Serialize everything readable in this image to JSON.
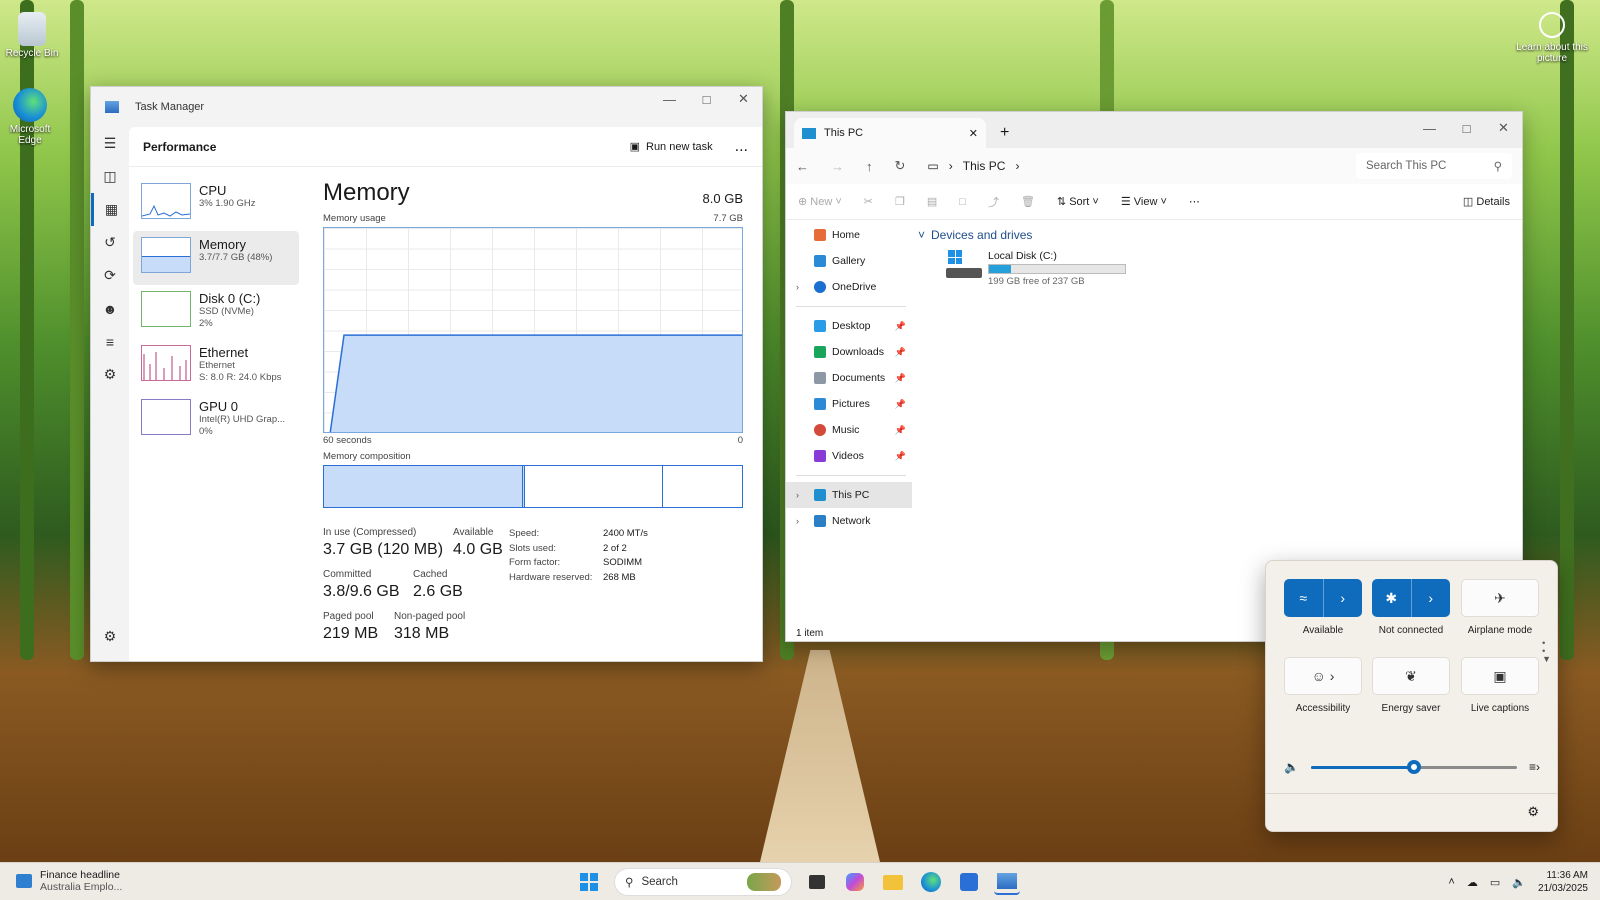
{
  "desktop": {
    "icons": [
      {
        "label": "Recycle Bin",
        "icon": "recycle-bin-icon"
      },
      {
        "label": "Microsoft Edge",
        "icon": "edge-icon"
      }
    ],
    "learn_label": "Learn about this picture"
  },
  "task_manager": {
    "title": "Task Manager",
    "page": "Performance",
    "run_new_task": "Run new task",
    "more": "...",
    "perf_items": [
      {
        "name": "CPU",
        "sub1": "3% 1.90 GHz",
        "sub2": ""
      },
      {
        "name": "Memory",
        "sub1": "3.7/7.7 GB (48%)",
        "sub2": ""
      },
      {
        "name": "Disk 0 (C:)",
        "sub1": "SSD (NVMe)",
        "sub2": "2%"
      },
      {
        "name": "Ethernet",
        "sub1": "Ethernet",
        "sub2": "S: 8.0 R: 24.0 Kbps"
      },
      {
        "name": "GPU 0",
        "sub1": "Intel(R) UHD Grap...",
        "sub2": "0%"
      }
    ],
    "memory": {
      "title": "Memory",
      "total": "8.0 GB",
      "usage_label": "Memory usage",
      "usage_max": "7.7 GB",
      "x_left": "60 seconds",
      "x_right": "0",
      "composition_label": "Memory composition",
      "usage_series": [
        0,
        48,
        48,
        48,
        48,
        48,
        48,
        48,
        48,
        48,
        48,
        48,
        48,
        48,
        48,
        48,
        48,
        48,
        48,
        48,
        48,
        48
      ],
      "in_use_label": "In use (Compressed)",
      "in_use_value": "3.7 GB (120 MB)",
      "available_label": "Available",
      "available_value": "4.0 GB",
      "committed_label": "Committed",
      "committed_value": "3.8/9.6 GB",
      "cached_label": "Cached",
      "cached_value": "2.6 GB",
      "paged_label": "Paged pool",
      "paged_value": "219 MB",
      "nonpaged_label": "Non-paged pool",
      "nonpaged_value": "318 MB",
      "specs": [
        {
          "k": "Speed:",
          "v": "2400 MT/s"
        },
        {
          "k": "Slots used:",
          "v": "2 of 2"
        },
        {
          "k": "Form factor:",
          "v": "SODIMM"
        },
        {
          "k": "Hardware reserved:",
          "v": "268 MB"
        }
      ]
    }
  },
  "explorer": {
    "tab_title": "This PC",
    "breadcrumb": "This PC",
    "search_placeholder": "Search This PC",
    "cmd": {
      "new": "New",
      "sort": "Sort",
      "view": "View",
      "details": "Details"
    },
    "sidebar": {
      "top": [
        "Home",
        "Gallery",
        "OneDrive"
      ],
      "pinned": [
        "Desktop",
        "Downloads",
        "Documents",
        "Pictures",
        "Music",
        "Videos"
      ],
      "bottom": [
        "This PC",
        "Network"
      ]
    },
    "group": "Devices and drives",
    "drive": {
      "name": "Local Disk (C:)",
      "free": "199 GB free of 237 GB",
      "used_fraction": 0.16
    },
    "status": "1 item"
  },
  "quick_settings": {
    "tiles": [
      {
        "label": "Available",
        "icon": "wifi-icon"
      },
      {
        "label": "Not connected",
        "icon": "bluetooth-icon"
      },
      {
        "label": "Airplane mode",
        "icon": "airplane-icon"
      },
      {
        "label": "Accessibility",
        "icon": "accessibility-icon"
      },
      {
        "label": "Energy saver",
        "icon": "leaf-icon"
      },
      {
        "label": "Live captions",
        "icon": "captions-icon"
      }
    ],
    "volume_fraction": 0.5
  },
  "taskbar": {
    "news_title": "Finance headline",
    "news_sub": "Australia Emplo...",
    "search": "Search",
    "time": "11:36 AM",
    "date": "21/03/2025"
  }
}
